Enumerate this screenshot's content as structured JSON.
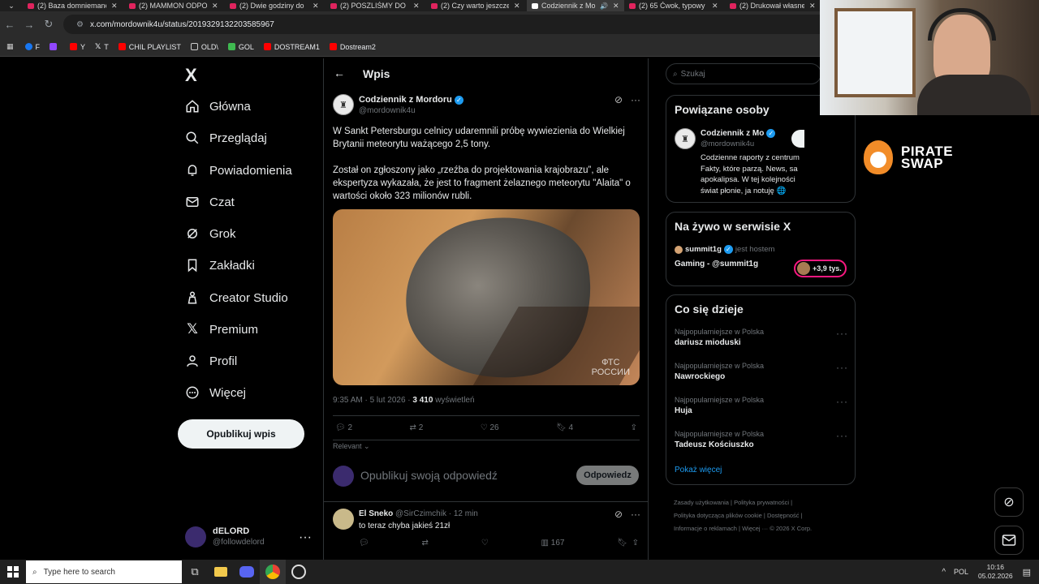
{
  "browser": {
    "tabs": [
      {
        "label": "(2) Baza domniemane"
      },
      {
        "label": "(2) MAMMON ODPO"
      },
      {
        "label": "(2) Dwie godziny do"
      },
      {
        "label": "(2) POSZLIŚMY DO N"
      },
      {
        "label": "(2) Czy warto jeszcze"
      },
      {
        "label": "Codziennik z Mo",
        "active": true
      },
      {
        "label": "(2) 65 Ćwok, typowy"
      },
      {
        "label": "(2) Drukował własne"
      }
    ],
    "url": "x.com/mordownik4u/status/2019329132203585967",
    "bookmarks": [
      {
        "label": "F",
        "color": "#1877f2"
      },
      {
        "label": "",
        "color": "#9147ff"
      },
      {
        "label": "Y",
        "color": "#ff0000"
      },
      {
        "label": "T",
        "color": "#ffffff"
      },
      {
        "label": "CHIL PLAYLIST",
        "color": "#ff0000"
      },
      {
        "label": "OLD\\",
        "color": "#f2c94c"
      },
      {
        "label": "GOL",
        "color": "#3fb950"
      },
      {
        "label": "DOSTREAM1",
        "color": "#ff0000"
      },
      {
        "label": "Dostream2",
        "color": "#ff0000"
      }
    ]
  },
  "sidebar": {
    "logo": "X",
    "items": [
      {
        "label": "Główna",
        "icon": "home-icon"
      },
      {
        "label": "Przeglądaj",
        "icon": "search-icon"
      },
      {
        "label": "Powiadomienia",
        "icon": "bell-icon"
      },
      {
        "label": "Czat",
        "icon": "mail-icon"
      },
      {
        "label": "Grok",
        "icon": "grok-icon"
      },
      {
        "label": "Zakładki",
        "icon": "bookmark-icon"
      },
      {
        "label": "Creator Studio",
        "icon": "creator-icon"
      },
      {
        "label": "Premium",
        "icon": "x-icon"
      },
      {
        "label": "Profil",
        "icon": "profile-icon"
      },
      {
        "label": "Więcej",
        "icon": "more-icon"
      }
    ],
    "post_button": "Opublikuj wpis",
    "account": {
      "name": "dELORD",
      "handle": "@followdelord"
    }
  },
  "post": {
    "header_title": "Wpis",
    "author_name": "Codziennik z Mordoru",
    "author_handle": "@mordownik4u",
    "paragraph1": "W Sankt Petersburgu celnicy udaremnili próbę wywiezienia do Wielkiej Brytanii meteorytu ważącego 2,5 tony.",
    "paragraph2": "Został on zgłoszony jako „rzeźba do projektowania krajobrazu”, ale ekspertyza wykazała, że jest to fragment żelaznego meteorytu \"Alaita\" o wartości około 323 milionów rubli.",
    "watermark_line1": "ФТС",
    "watermark_line2": "РОССИИ",
    "timestamp": "9:35 AM · 5 lut 2026 · ",
    "views_count": "3 410",
    "views_label": " wyświetleń",
    "replies": "2",
    "reposts": "2",
    "likes": "26",
    "bookmarks": "4",
    "sort_label": "Relevant",
    "reply_placeholder": "Opublikuj swoją odpowiedź",
    "reply_button": "Odpowiedz"
  },
  "reply": {
    "author_name": "El Sneko",
    "author_handle": "@SirCzimchik",
    "time": "· 12 min",
    "text": "to teraz chyba jakieś 21zł",
    "views": "167"
  },
  "right": {
    "search_placeholder": "Szukaj",
    "related_title": "Powiązane osoby",
    "related_name": "Codziennik z Mo",
    "related_handle": "@mordownik4u",
    "related_bio_lines": [
      "Codzienne raporty z centrum",
      "Fakty, które parzą. News, sa",
      "apokalipsa. W tej kolejności",
      "świat płonie, ja notuję 🌐"
    ],
    "live_title": "Na żywo w serwisie X",
    "live_host": "summit1g",
    "live_host_label": "jest hostem",
    "live_stream_title": "Gaming - @summit1g",
    "live_viewers": "+3,9 tys.",
    "trends_title": "Co się dzieje",
    "trends": [
      {
        "category": "Najpopularniejsze w Polska",
        "name": "dariusz mioduski"
      },
      {
        "category": "Najpopularniejsze w Polska",
        "name": "Nawrockiego"
      },
      {
        "category": "Najpopularniejsze w Polska",
        "name": "Huja"
      },
      {
        "category": "Najpopularniejsze w Polska",
        "name": "Tadeusz Kościuszko"
      }
    ],
    "show_more": "Pokaż więcej",
    "footer_line1": [
      "Zasady użytkowania",
      "|",
      "Polityka prywatności",
      "|"
    ],
    "footer_line2": [
      "Polityka dotycząca plików cookie",
      "|",
      "Dostępność",
      "|"
    ],
    "footer_line3": [
      "Informacje o reklamach",
      "|",
      "Więcej ···",
      "© 2026 X Corp."
    ]
  },
  "overlay": {
    "brand_line1": "PIRATE",
    "brand_line2": "SWAP"
  },
  "taskbar": {
    "search_placeholder": "Type here to search",
    "language": "POL",
    "time": "10:16",
    "date": "05.02.2026"
  },
  "colors": {
    "accent": "#1d9bf0",
    "brand_orange": "#f28c28",
    "live_pink": "#f91880"
  }
}
